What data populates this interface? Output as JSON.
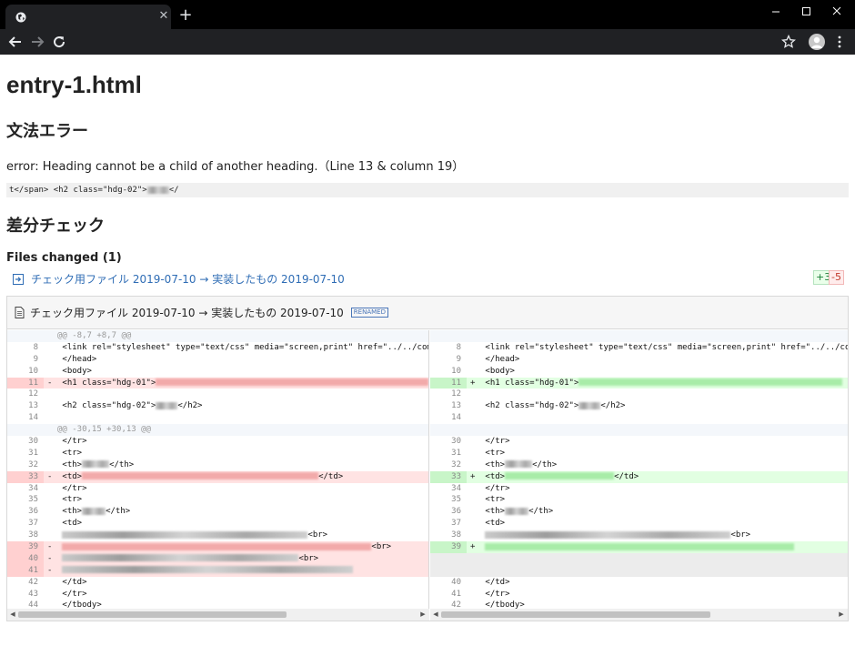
{
  "browser": {
    "new_tab_label": "+",
    "tab_close_label": "✕"
  },
  "page": {
    "title": "entry-1.html",
    "syntax_heading": "文法エラー",
    "error_message": "error: Heading cannot be a child of another heading.（Line 13 & column 19）",
    "code_snippet_before": "t</span> <h2 class=\"hdg-02\">",
    "code_snippet_after": "</",
    "diff_heading": "差分チェック",
    "files_changed": "Files changed (1)",
    "file_link": "チェック用ファイル 2019-07-10 → 実装したもの 2019-07-10",
    "additions": "+3",
    "deletions": "-5",
    "file_header": "チェック用ファイル 2019-07-10 → 実装したもの 2019-07-10",
    "renamed_badge": "RENAMED"
  },
  "diff": {
    "left": [
      {
        "type": "hunk",
        "num": "",
        "mark": "",
        "code": "@@ -8,7 +8,7 @@"
      },
      {
        "type": "ctx",
        "num": "8",
        "mark": "",
        "code": "<link rel=\"stylesheet\" type=\"text/css\" media=\"screen,print\" href=\"../../common/"
      },
      {
        "type": "ctx",
        "num": "9",
        "mark": "",
        "code": "</head>"
      },
      {
        "type": "ctx",
        "num": "10",
        "mark": "",
        "code": "<body>"
      },
      {
        "type": "del",
        "num": "11",
        "mark": "-",
        "code": "<h1 class=\"hdg-01\">"
      },
      {
        "type": "ctx",
        "num": "12",
        "mark": "",
        "code": ""
      },
      {
        "type": "ctx",
        "num": "13",
        "mark": "",
        "code": "<h2 class=\"hdg-02\">"
      },
      {
        "type": "ctx",
        "num": "14",
        "mark": "",
        "code": ""
      },
      {
        "type": "hunk",
        "num": "",
        "mark": "",
        "code": "@@ -30,15 +30,13 @@"
      },
      {
        "type": "ctx",
        "num": "30",
        "mark": "",
        "code": "</tr>"
      },
      {
        "type": "ctx",
        "num": "31",
        "mark": "",
        "code": "<tr>"
      },
      {
        "type": "ctx",
        "num": "32",
        "mark": "",
        "code": "<th>"
      },
      {
        "type": "del",
        "num": "33",
        "mark": "-",
        "code": "<td>"
      },
      {
        "type": "ctx",
        "num": "34",
        "mark": "",
        "code": "</tr>"
      },
      {
        "type": "ctx",
        "num": "35",
        "mark": "",
        "code": "<tr>"
      },
      {
        "type": "ctx",
        "num": "36",
        "mark": "",
        "code": "<th>"
      },
      {
        "type": "ctx",
        "num": "37",
        "mark": "",
        "code": "<td>"
      },
      {
        "type": "ctx",
        "num": "38",
        "mark": "",
        "code": ""
      },
      {
        "type": "del",
        "num": "39",
        "mark": "-",
        "code": ""
      },
      {
        "type": "del",
        "num": "40",
        "mark": "-",
        "code": ""
      },
      {
        "type": "del",
        "num": "41",
        "mark": "-",
        "code": ""
      },
      {
        "type": "ctx",
        "num": "42",
        "mark": "",
        "code": "</td>"
      },
      {
        "type": "ctx",
        "num": "43",
        "mark": "",
        "code": "</tr>"
      },
      {
        "type": "ctx",
        "num": "44",
        "mark": "",
        "code": "</tbody>"
      }
    ],
    "right": [
      {
        "type": "hunk",
        "num": "",
        "mark": "",
        "code": ""
      },
      {
        "type": "ctx",
        "num": "8",
        "mark": "",
        "code": "<link rel=\"stylesheet\" type=\"text/css\" media=\"screen,print\" href=\"../../common/"
      },
      {
        "type": "ctx",
        "num": "9",
        "mark": "",
        "code": "</head>"
      },
      {
        "type": "ctx",
        "num": "10",
        "mark": "",
        "code": "<body>"
      },
      {
        "type": "ins",
        "num": "11",
        "mark": "+",
        "code": "<h1 class=\"hdg-01\">"
      },
      {
        "type": "ctx",
        "num": "12",
        "mark": "",
        "code": ""
      },
      {
        "type": "ctx",
        "num": "13",
        "mark": "",
        "code": "<h2 class=\"hdg-02\">"
      },
      {
        "type": "ctx",
        "num": "14",
        "mark": "",
        "code": ""
      },
      {
        "type": "hunk",
        "num": "",
        "mark": "",
        "code": ""
      },
      {
        "type": "ctx",
        "num": "30",
        "mark": "",
        "code": "</tr>"
      },
      {
        "type": "ctx",
        "num": "31",
        "mark": "",
        "code": "<tr>"
      },
      {
        "type": "ctx",
        "num": "32",
        "mark": "",
        "code": "<th>"
      },
      {
        "type": "ins",
        "num": "33",
        "mark": "+",
        "code": "<td>"
      },
      {
        "type": "ctx",
        "num": "34",
        "mark": "",
        "code": "</tr>"
      },
      {
        "type": "ctx",
        "num": "35",
        "mark": "",
        "code": "<tr>"
      },
      {
        "type": "ctx",
        "num": "36",
        "mark": "",
        "code": "<th>"
      },
      {
        "type": "ctx",
        "num": "37",
        "mark": "",
        "code": "<td>"
      },
      {
        "type": "ctx",
        "num": "38",
        "mark": "",
        "code": ""
      },
      {
        "type": "ins",
        "num": "39",
        "mark": "+",
        "code": ""
      },
      {
        "type": "empty",
        "num": "",
        "mark": "",
        "code": ""
      },
      {
        "type": "empty",
        "num": "",
        "mark": "",
        "code": ""
      },
      {
        "type": "ctx",
        "num": "40",
        "mark": "",
        "code": "</td>"
      },
      {
        "type": "ctx",
        "num": "41",
        "mark": "",
        "code": "</tr>"
      },
      {
        "type": "ctx",
        "num": "42",
        "mark": "",
        "code": "</tbody>"
      }
    ],
    "tails": {
      "h2_close": "</h2>",
      "th_close": "</th>",
      "td_close": "</td>",
      "br": "<br>"
    }
  }
}
